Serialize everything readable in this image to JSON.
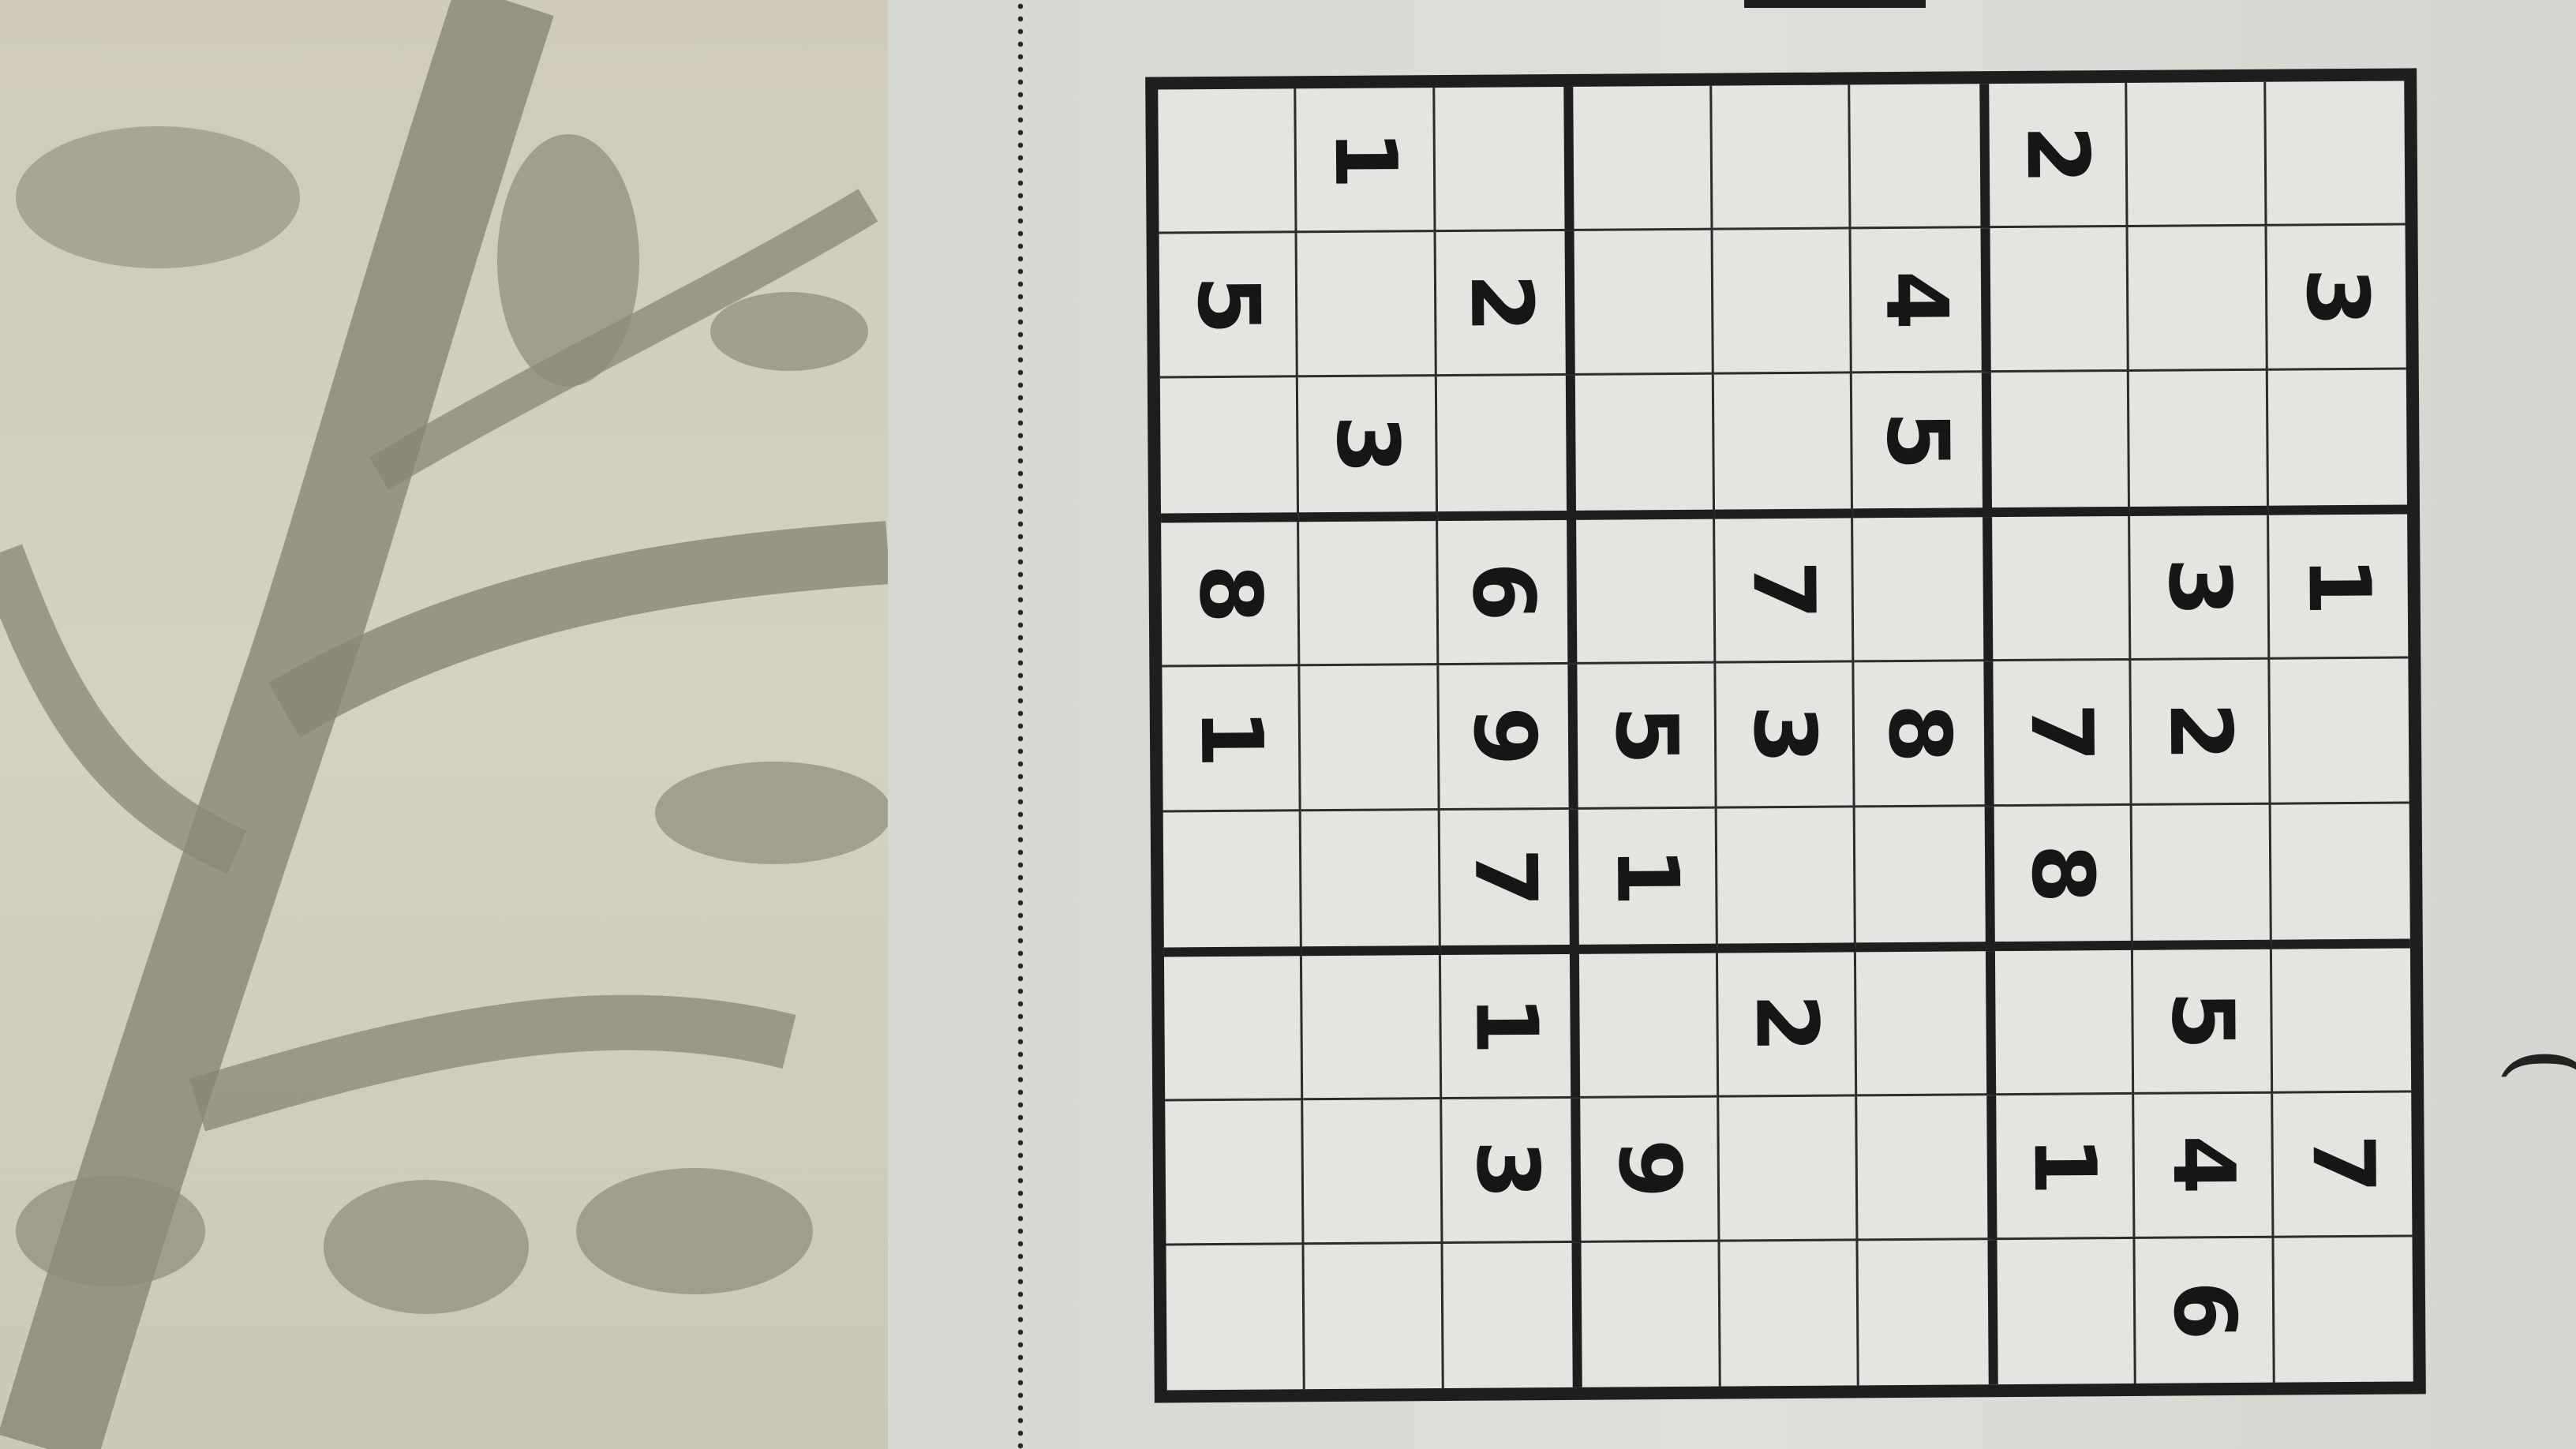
{
  "puzzle": {
    "rows": [
      [
        "",
        "1",
        "",
        "",
        "",
        "",
        "2",
        "",
        ""
      ],
      [
        "5",
        "",
        "2",
        "",
        "",
        "4",
        "",
        "",
        "3"
      ],
      [
        "",
        "3",
        "",
        "",
        "",
        "5",
        "",
        "",
        ""
      ],
      [
        "8",
        "",
        "6",
        "",
        "7",
        "",
        "",
        "3",
        "1"
      ],
      [
        "1",
        "",
        "9",
        "5",
        "3",
        "8",
        "7",
        "2",
        ""
      ],
      [
        "",
        "",
        "7",
        "1",
        "",
        "",
        "8",
        "",
        ""
      ],
      [
        "",
        "",
        "1",
        "",
        "2",
        "",
        "",
        "5",
        ""
      ],
      [
        "",
        "",
        "3",
        "9",
        "",
        "",
        "1",
        "4",
        "7"
      ],
      [
        "",
        "",
        "",
        "",
        "",
        "",
        "",
        "6",
        ""
      ]
    ]
  },
  "edge_text": "(",
  "colors": {
    "grid_line": "#1e1e1e",
    "digit": "#161616",
    "paper": "#dededa"
  }
}
